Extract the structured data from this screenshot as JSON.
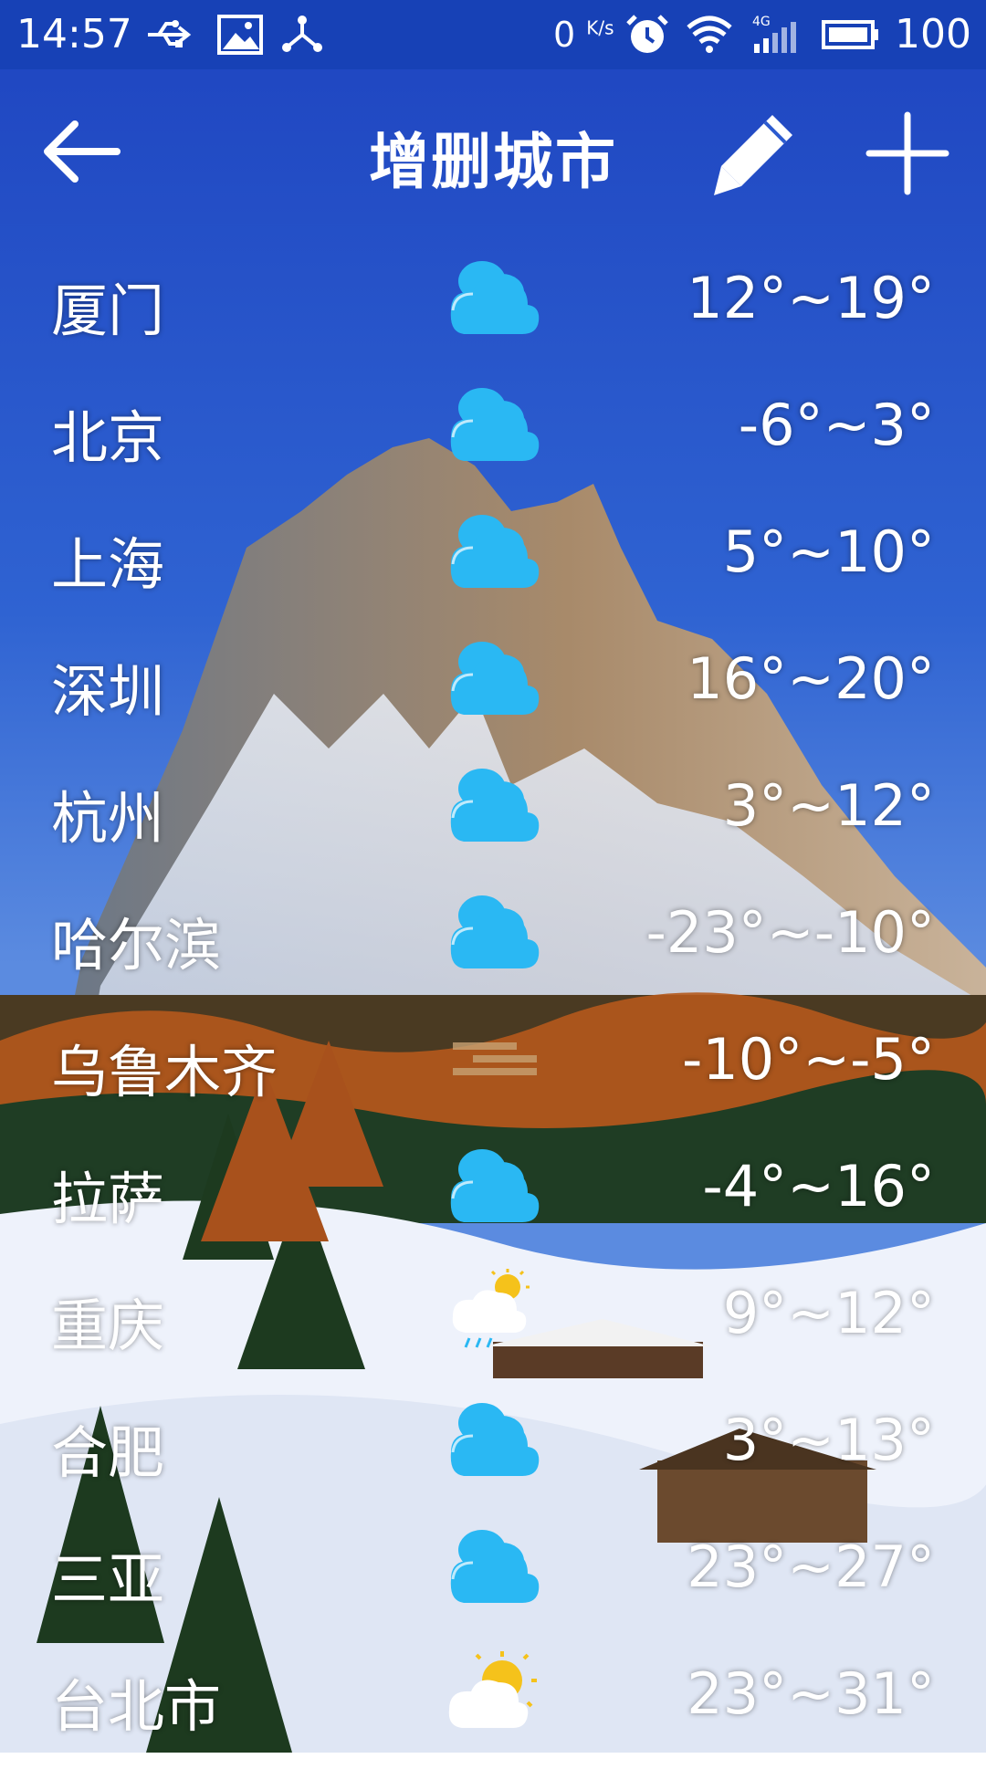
{
  "status_bar": {
    "time": "14:57",
    "net_speed": "0",
    "net_speed_unit": "K/s",
    "network": "4G",
    "battery": "100",
    "icons": [
      "usb-icon",
      "image-icon",
      "share-hub-icon",
      "alarm-icon",
      "wifi-icon",
      "signal-icon",
      "battery-icon"
    ]
  },
  "toolbar": {
    "title": "增删城市",
    "back_icon": "arrow-left-icon",
    "edit_icon": "pencil-icon",
    "add_icon": "plus-icon"
  },
  "colors": {
    "status_bar_bg": "#1741b6",
    "cloud_icon": "#2ab8f3",
    "sun_icon": "#f5c21b"
  },
  "cities": [
    {
      "name": "厦门",
      "weather": "cloudy-icon",
      "temp": "12°~19°"
    },
    {
      "name": "北京",
      "weather": "cloudy-icon",
      "temp": "-6°~3°"
    },
    {
      "name": "上海",
      "weather": "cloudy-icon",
      "temp": "5°~10°"
    },
    {
      "name": "深圳",
      "weather": "cloudy-icon",
      "temp": "16°~20°"
    },
    {
      "name": "杭州",
      "weather": "cloudy-icon",
      "temp": "3°~12°"
    },
    {
      "name": "哈尔滨",
      "weather": "cloudy-icon",
      "temp": "-23°~-10°"
    },
    {
      "name": "乌鲁木齐",
      "weather": "haze-icon",
      "temp": "-10°~-5°"
    },
    {
      "name": "拉萨",
      "weather": "cloudy-icon",
      "temp": "-4°~16°"
    },
    {
      "name": "重庆",
      "weather": "sun-shower-icon",
      "temp": "9°~12°"
    },
    {
      "name": "合肥",
      "weather": "cloudy-icon",
      "temp": "3°~13°"
    },
    {
      "name": "三亚",
      "weather": "cloudy-icon",
      "temp": "23°~27°"
    },
    {
      "name": "台北市",
      "weather": "partly-sunny-icon",
      "temp": "23°~31°"
    }
  ]
}
